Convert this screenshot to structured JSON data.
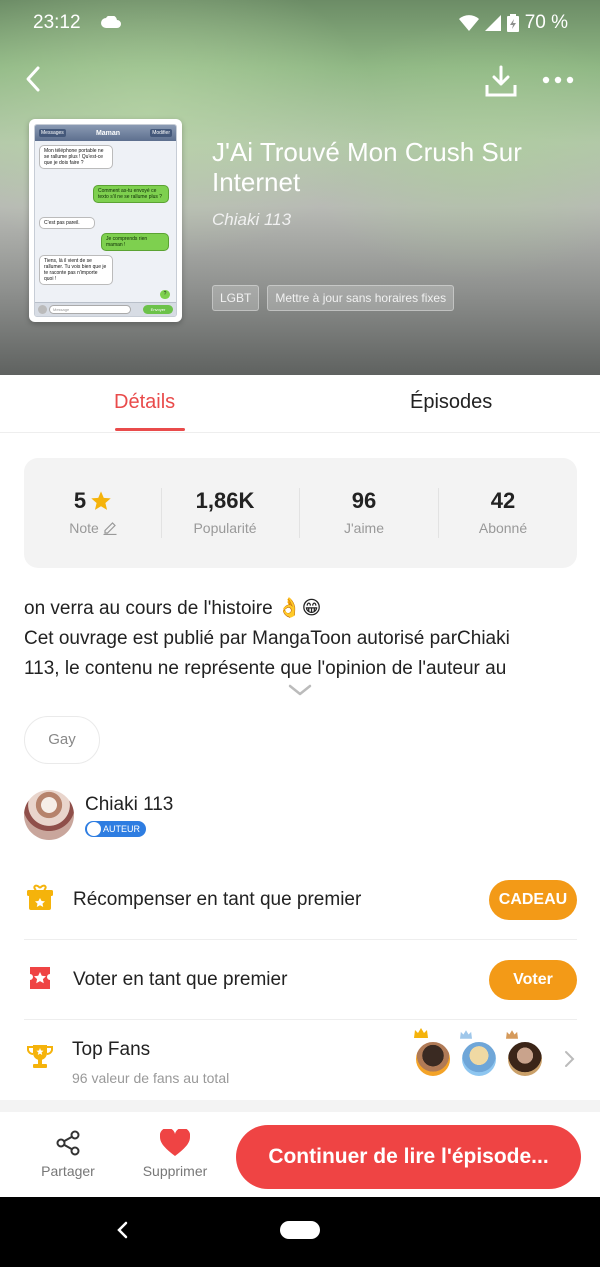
{
  "status_bar": {
    "time": "23:12",
    "battery": "70 %"
  },
  "book": {
    "title": "J'Ai Trouvé Mon Crush Sur Internet",
    "author": "Chiaki 113",
    "tags": [
      "LGBT",
      "Mettre à jour sans horaires fixes"
    ],
    "cover": {
      "header_left": "Messages",
      "header_title": "Maman",
      "header_right": "Modifier",
      "bubbles": [
        "Mon téléphone portable ne se rallume plus ! Qu'est-ce que je dois faire ?",
        "Comment as-tu envoyé ce texto s'il ne se rallume plus ?",
        "C'est pas pareil.",
        "Je comprends rien maman !",
        "Tiens, là il vient de se rallumer. Tu vois bien que je te raconte pas n'importe quoi !"
      ],
      "question_mark": "?",
      "input_placeholder": "Message",
      "send_label": "Envoyer"
    }
  },
  "tabs": {
    "details": "Détails",
    "episodes": "Épisodes"
  },
  "stats": [
    {
      "value": "5",
      "label": "Note"
    },
    {
      "value": "1,86K",
      "label": "Popularité"
    },
    {
      "value": "96",
      "label": "J'aime"
    },
    {
      "value": "42",
      "label": "Abonné"
    }
  ],
  "description": {
    "line1": "on verra au cours de l'histoire 👌😁",
    "line2": "Cet ouvrage est publié par MangaToon  autorisé parChiaki",
    "line3": "113, le contenu ne représente que l'opinion de l'auteur au"
  },
  "genre_chip": "Gay",
  "author_section": {
    "name": "Chiaki 113",
    "badge": "AUTEUR"
  },
  "actions": {
    "reward_label": "Récompenser en tant que premier",
    "reward_button": "CADEAU",
    "vote_label": "Voter en tant que premier",
    "vote_button": "Voter"
  },
  "top_fans": {
    "title": "Top Fans",
    "subtitle": "96 valeur de fans au total"
  },
  "bottom_bar": {
    "share": "Partager",
    "delete": "Supprimer",
    "continue": "Continuer de lire l'épisode..."
  },
  "colors": {
    "accent": "#e94b4b",
    "orange": "#f39a17",
    "cta": "#ef4444"
  }
}
